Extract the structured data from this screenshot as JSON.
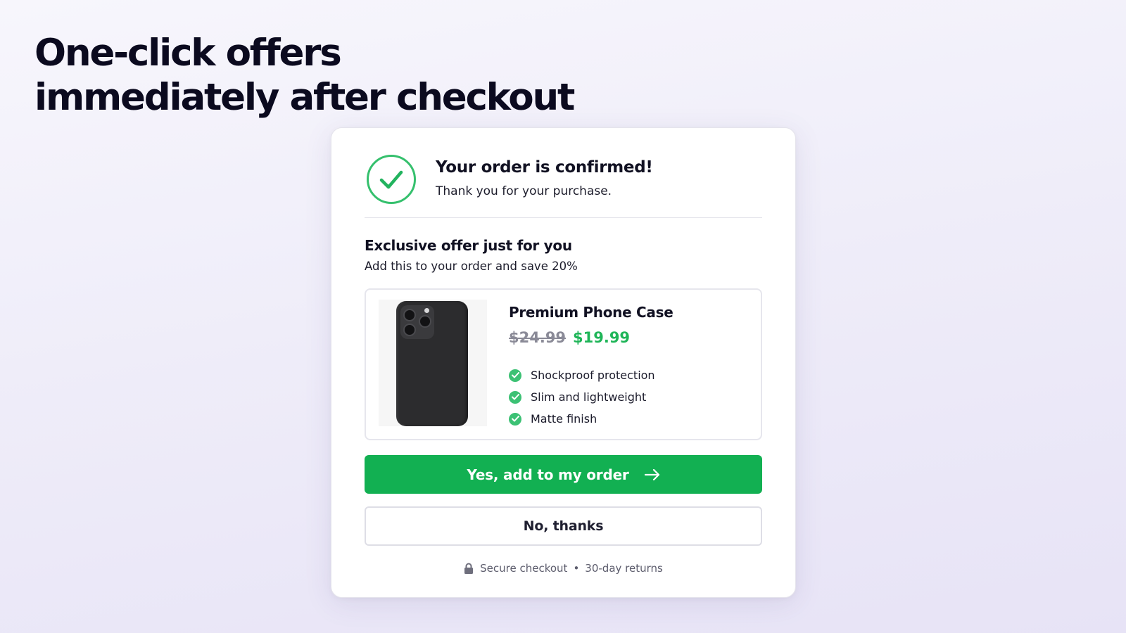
{
  "hero": {
    "title_line1": "One-click offers",
    "title_line2": "immediately after checkout"
  },
  "confirmation": {
    "icon": "check-circle-icon",
    "title": "Your order is confirmed!",
    "subtitle": "Thank you for your purchase."
  },
  "offer": {
    "title": "Exclusive offer just for you",
    "subtitle": "Add this to your order and save 20%",
    "product": {
      "name": "Premium Phone Case",
      "image": "phone-case-image",
      "original_price": "$24.99",
      "sale_price": "$19.99",
      "features": [
        "Shockproof protection",
        "Slim and lightweight",
        "Matte finish"
      ]
    }
  },
  "actions": {
    "accept_label": "Yes, add to my order",
    "decline_label": "No, thanks"
  },
  "footer": {
    "secure_label": "Secure checkout",
    "separator": "•",
    "returns_label": "30-day returns"
  },
  "colors": {
    "accent_green": "#12b052",
    "sale_price_green": "#1fb558",
    "check_green": "#35c06d",
    "background": "#efedf9"
  }
}
